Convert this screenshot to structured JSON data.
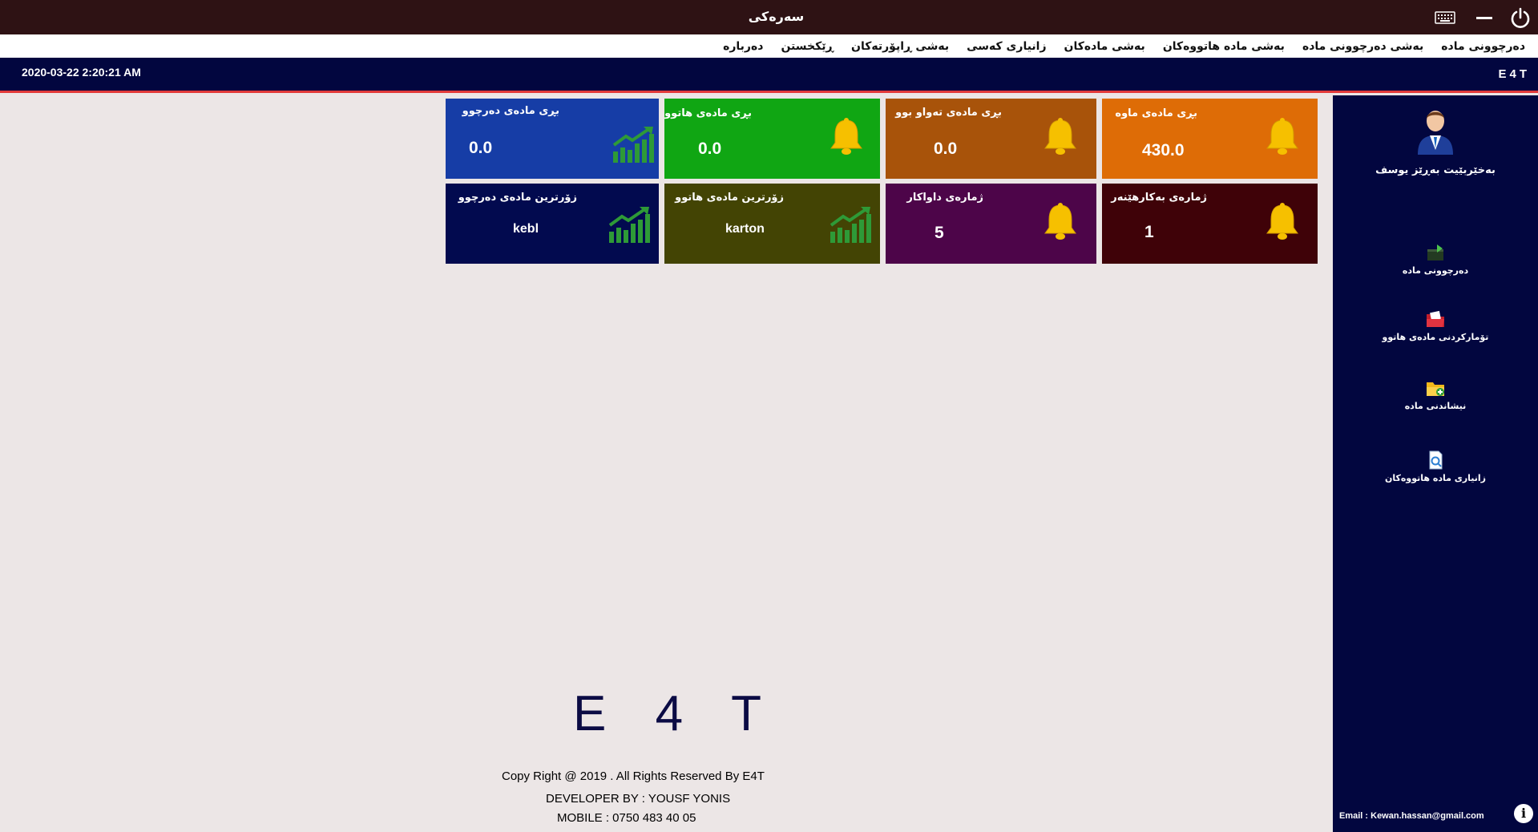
{
  "window": {
    "title": "سەرەکی",
    "keyboard_icon": "keyboard-icon",
    "minimize_icon": "minimize-icon",
    "power_icon": "power-icon"
  },
  "menu": [
    "دەرچوونی مادە",
    "بەشی دەرچوونی مادە",
    "بەشی مادە هاتووەکان",
    "بەشی مادەکان",
    "زانیاری کەسی",
    "بەشی ڕاپۆرتەکان",
    "ڕێکخستن",
    "دەربارە"
  ],
  "infobar": {
    "datetime": "2020-03-22 2:20:21 AM",
    "brand": "E4T"
  },
  "cards": [
    {
      "title": "بڕی مادەی ماوە",
      "value": "430.0",
      "color": "#de6c06",
      "icon": "bell-icon"
    },
    {
      "title": "بڕی مادەی تەواو بوو",
      "value": "0.0",
      "color": "#a8530a",
      "icon": "bell-icon"
    },
    {
      "title": "بڕی مادەی هاتوو",
      "value": "0.0",
      "color": "#10a613",
      "icon": "bell-icon"
    },
    {
      "title": "بڕی مادەی دەرچوو",
      "value": "0.0",
      "color": "#163da6",
      "icon": "chart-up-icon"
    },
    {
      "title": "ژمارەی بەکارهێنەر",
      "value": "1",
      "color": "#3f0208",
      "icon": "bell-icon"
    },
    {
      "title": "ژمارەی داواکار",
      "value": "5",
      "color": "#4d0549",
      "icon": "bell-icon"
    },
    {
      "title": "زۆرترین مادەی هاتوو",
      "value": "karton",
      "color": "#434404",
      "icon": "chart-up-icon"
    },
    {
      "title": "زۆرترین مادەی دەرچوو",
      "value": "kebl",
      "color": "#020a4f",
      "icon": "chart-up-icon"
    }
  ],
  "sidebar": {
    "user": "بەخێربێیت بەڕێز  یوسف",
    "items": [
      {
        "label": "دەرچوونی مادە",
        "icon": "export-box-icon"
      },
      {
        "label": "تۆمارکردنی مادەی هاتوو",
        "icon": "folder-red-icon"
      },
      {
        "label": "نیشاندنی مادە",
        "icon": "folder-add-icon"
      },
      {
        "label": "زانیاری مادە هاتووەکان",
        "icon": "document-search-icon"
      }
    ],
    "email": "Email : Kewan.hassan@gmail.com"
  },
  "footer": {
    "logo": "E 4 T",
    "copyright": "Copy Right @ 2019 . All  Rights Reserved By E4T",
    "developer": "DEVELOPER BY : YOUSF YONIS",
    "mobile": "MOBILE : 0750 483 40 05"
  }
}
